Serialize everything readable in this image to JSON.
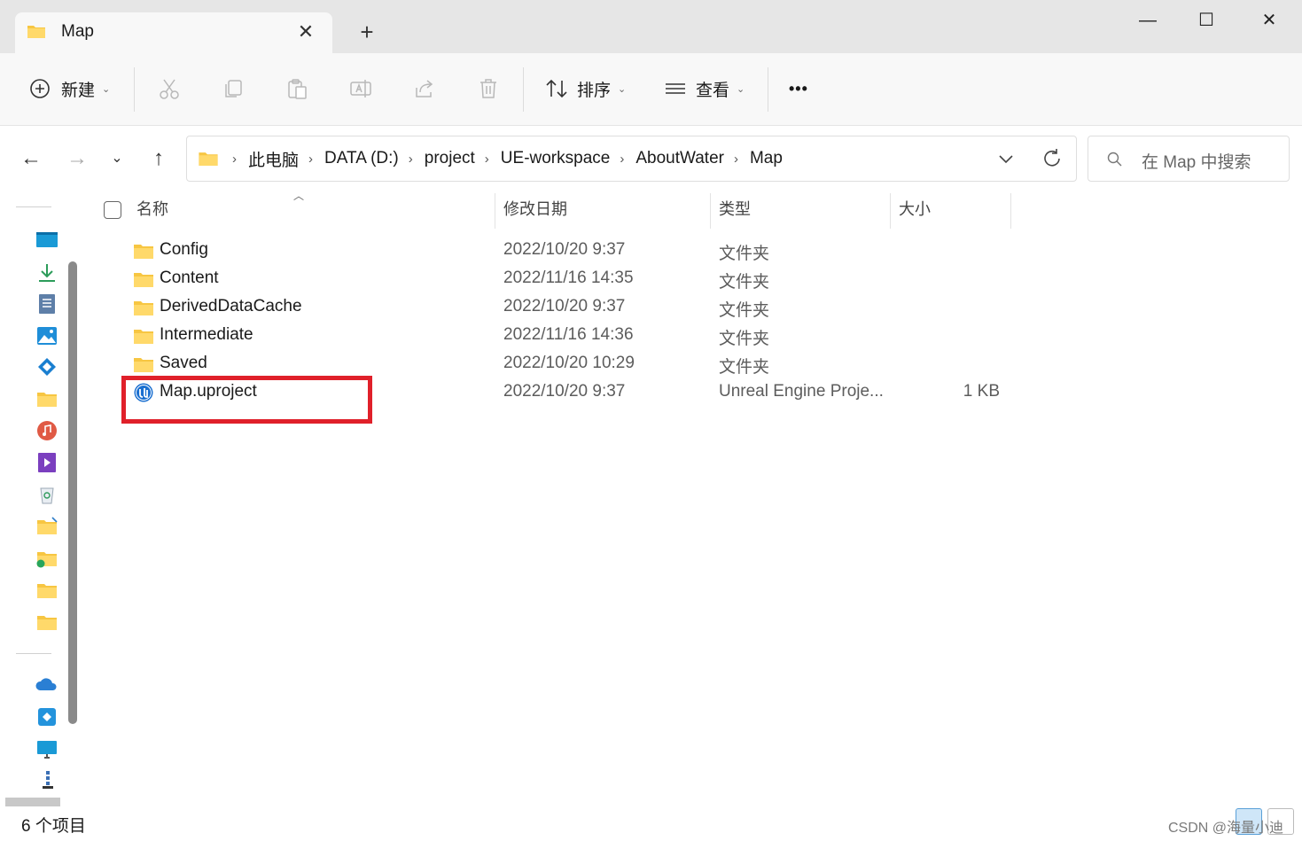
{
  "window": {
    "tab_title": "Map",
    "close_tab": "✕",
    "new_tab": "+",
    "minimize": "—",
    "maximize": "☐",
    "close": "✕"
  },
  "toolbar": {
    "new_label": "新建",
    "sort_label": "排序",
    "view_label": "查看",
    "more_label": "•••"
  },
  "address": {
    "crumbs": [
      "此电脑",
      "DATA (D:)",
      "project",
      "UE-workspace",
      "AboutWater",
      "Map"
    ],
    "separator": "›"
  },
  "search": {
    "placeholder": "在 Map 中搜索"
  },
  "columns": {
    "name": "名称",
    "modified": "修改日期",
    "type": "类型",
    "size": "大小"
  },
  "files": [
    {
      "name": "Config",
      "modified": "2022/10/20 9:37",
      "type": "文件夹",
      "size": "",
      "icon": "folder-icon"
    },
    {
      "name": "Content",
      "modified": "2022/11/16 14:35",
      "type": "文件夹",
      "size": "",
      "icon": "folder-icon"
    },
    {
      "name": "DerivedDataCache",
      "modified": "2022/10/20 9:37",
      "type": "文件夹",
      "size": "",
      "icon": "folder-icon"
    },
    {
      "name": "Intermediate",
      "modified": "2022/11/16 14:36",
      "type": "文件夹",
      "size": "",
      "icon": "folder-icon"
    },
    {
      "name": "Saved",
      "modified": "2022/10/20 10:29",
      "type": "文件夹",
      "size": "",
      "icon": "folder-icon"
    },
    {
      "name": "Map.uproject",
      "modified": "2022/10/20 9:37",
      "type": "Unreal Engine Proje...",
      "size": "1 KB",
      "icon": "unreal-engine-icon"
    }
  ],
  "status": {
    "item_count": "6 个项目"
  },
  "watermark": "CSDN @海量小迪",
  "colors": {
    "folder": "#f7c642",
    "highlight": "#e0202a",
    "accent": "#0067c0"
  }
}
